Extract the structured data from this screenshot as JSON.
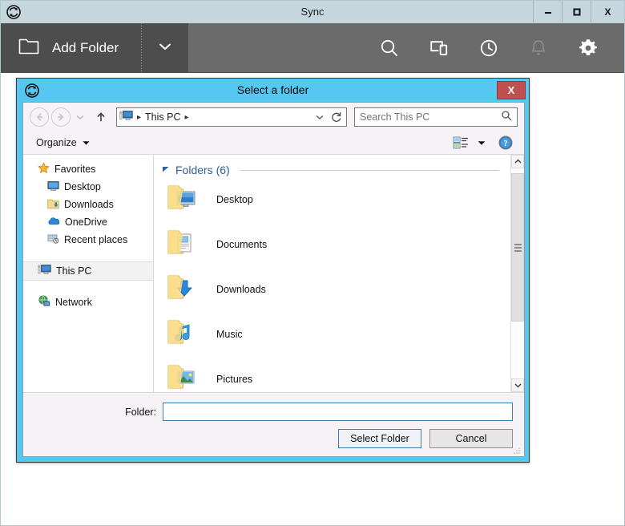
{
  "app": {
    "title": "Sync",
    "logo_icon": "sync-circular-arrows-icon",
    "window_controls": {
      "minimize": "–",
      "maximize": "□",
      "close": "X"
    }
  },
  "toolbar": {
    "add_folder_label": "Add Folder",
    "add_folder_icon": "folder-outline-icon",
    "add_folder_caret_icon": "chevron-down-icon",
    "icons": [
      {
        "name": "search-icon",
        "label": "Search"
      },
      {
        "name": "devices-icon",
        "label": "Devices"
      },
      {
        "name": "history-clock-icon",
        "label": "History"
      },
      {
        "name": "bell-notification-icon",
        "label": "Notifications"
      },
      {
        "name": "gear-settings-icon",
        "label": "Settings"
      }
    ],
    "colors": {
      "toolbar_bg": "#6b6b6b",
      "add_folder_bg": "#4d4d4d",
      "titlebar_bg": "#c5d6dd"
    }
  },
  "dialog": {
    "title": "Select a folder",
    "icon": "sync-circular-arrows-icon",
    "close_label": "X",
    "accent_color": "#55c7f0",
    "nav": {
      "back_icon": "arrow-left-circle-icon",
      "forward_icon": "arrow-right-circle-icon",
      "recent_icon": "chevron-down-small-icon",
      "up_icon": "arrow-up-icon",
      "breadcrumb_icon": "this-pc-icon",
      "breadcrumb": "This PC",
      "breadcrumb_separator": "▸",
      "address_dropdown_icon": "chevron-down-icon",
      "refresh_icon": "refresh-icon"
    },
    "search": {
      "placeholder": "Search This PC",
      "icon": "search-icon"
    },
    "commandbar": {
      "organize_label": "Organize",
      "organize_caret_icon": "caret-down-icon",
      "view_icon": "view-layout-icon",
      "view_caret_icon": "caret-down-icon",
      "help_icon": "help-question-icon"
    },
    "nav_pane": {
      "items": [
        {
          "label": "Favorites",
          "icon": "star-favorites-icon",
          "level": 0,
          "selected": false
        },
        {
          "label": "Desktop",
          "icon": "desktop-monitor-icon",
          "level": 1,
          "selected": false
        },
        {
          "label": "Downloads",
          "icon": "downloads-folder-icon",
          "level": 1,
          "selected": false
        },
        {
          "label": "OneDrive",
          "icon": "onedrive-cloud-icon",
          "level": 1,
          "selected": false
        },
        {
          "label": "Recent places",
          "icon": "recent-places-icon",
          "level": 1,
          "selected": false
        },
        {
          "label": "This PC",
          "icon": "this-pc-icon",
          "level": 0,
          "selected": true
        },
        {
          "label": "Network",
          "icon": "network-globe-icon",
          "level": 0,
          "selected": false
        }
      ]
    },
    "list_pane": {
      "group_header": "Folders (6)",
      "group_collapse_icon": "triangle-collapse-icon",
      "folders": [
        {
          "label": "Desktop",
          "icon": "folder-desktop-icon"
        },
        {
          "label": "Documents",
          "icon": "folder-documents-icon"
        },
        {
          "label": "Downloads",
          "icon": "folder-downloads-icon"
        },
        {
          "label": "Music",
          "icon": "folder-music-icon"
        },
        {
          "label": "Pictures",
          "icon": "folder-pictures-icon"
        }
      ]
    },
    "scrollbar": {
      "up_icon": "scroll-up-arrow-icon",
      "down_icon": "scroll-down-arrow-icon",
      "thumb_name": "scrollbar-thumb"
    },
    "footer": {
      "folder_label": "Folder:",
      "folder_value": "",
      "folder_placeholder": "",
      "select_button": "Select Folder",
      "cancel_button": "Cancel",
      "resize_grip_icon": "resize-grip-icon"
    }
  }
}
